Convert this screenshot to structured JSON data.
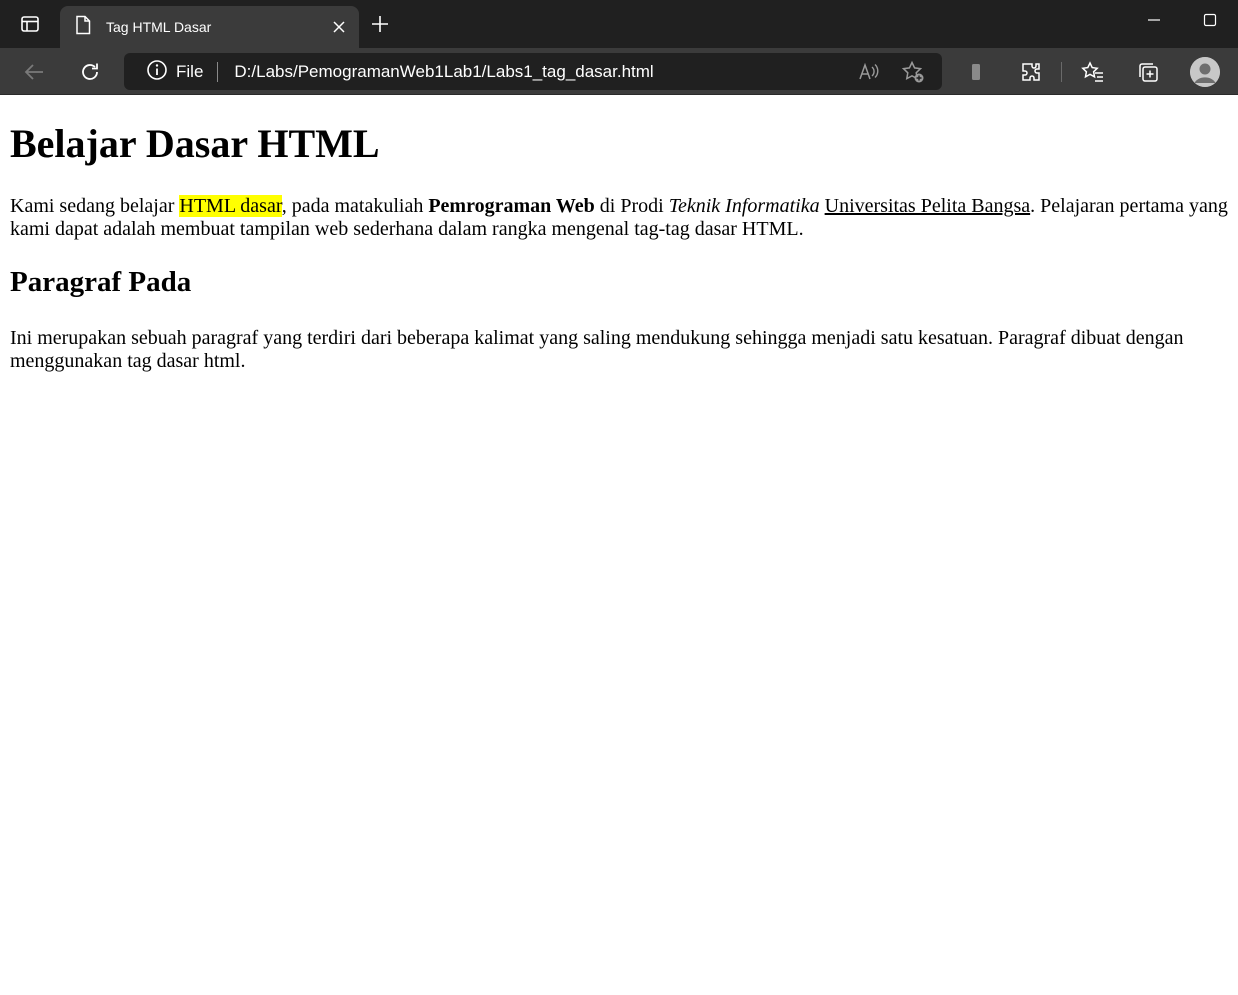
{
  "browser": {
    "tab_title": "Tag HTML Dasar",
    "address_scheme": "File",
    "address_url": "D:/Labs/PemogramanWeb1Lab1/Labs1_tag_dasar.html"
  },
  "icons": [
    "tab-actions-icon",
    "page-icon",
    "close-icon",
    "plus-icon",
    "minimize-icon",
    "maximize-icon",
    "back-arrow-icon",
    "refresh-icon",
    "info-icon",
    "read-aloud-icon",
    "add-favorite-icon",
    "phone-icon",
    "extensions-icon",
    "favorites-icon",
    "collections-icon",
    "profile-avatar-icon"
  ],
  "page": {
    "heading1": "Belajar Dasar HTML",
    "para1": {
      "t1": "Kami sedang belajar ",
      "highlight": "HTML dasar",
      "t2": ", pada matakuliah ",
      "bold": "Pemrograman Web",
      "t3": " di Prodi ",
      "italic": "Teknik Informatika",
      "t4": " ",
      "underline": "Universitas Pelita Bangsa",
      "t5": ". Pelajaran pertama yang kami dapat adalah membuat tampilan web sederhana dalam rangka mengenal tag-tag dasar HTML."
    },
    "heading2": "Paragraf Pada",
    "para2": "Ini merupakan sebuah paragraf yang terdiri dari beberapa kalimat yang saling mendukung sehingga menjadi satu kesatuan. Paragraf dibuat dengan menggunakan tag dasar html."
  },
  "colors": {
    "titlebar": "#202020",
    "toolbar": "#3b3b3b",
    "highlight": "#ffff00"
  }
}
